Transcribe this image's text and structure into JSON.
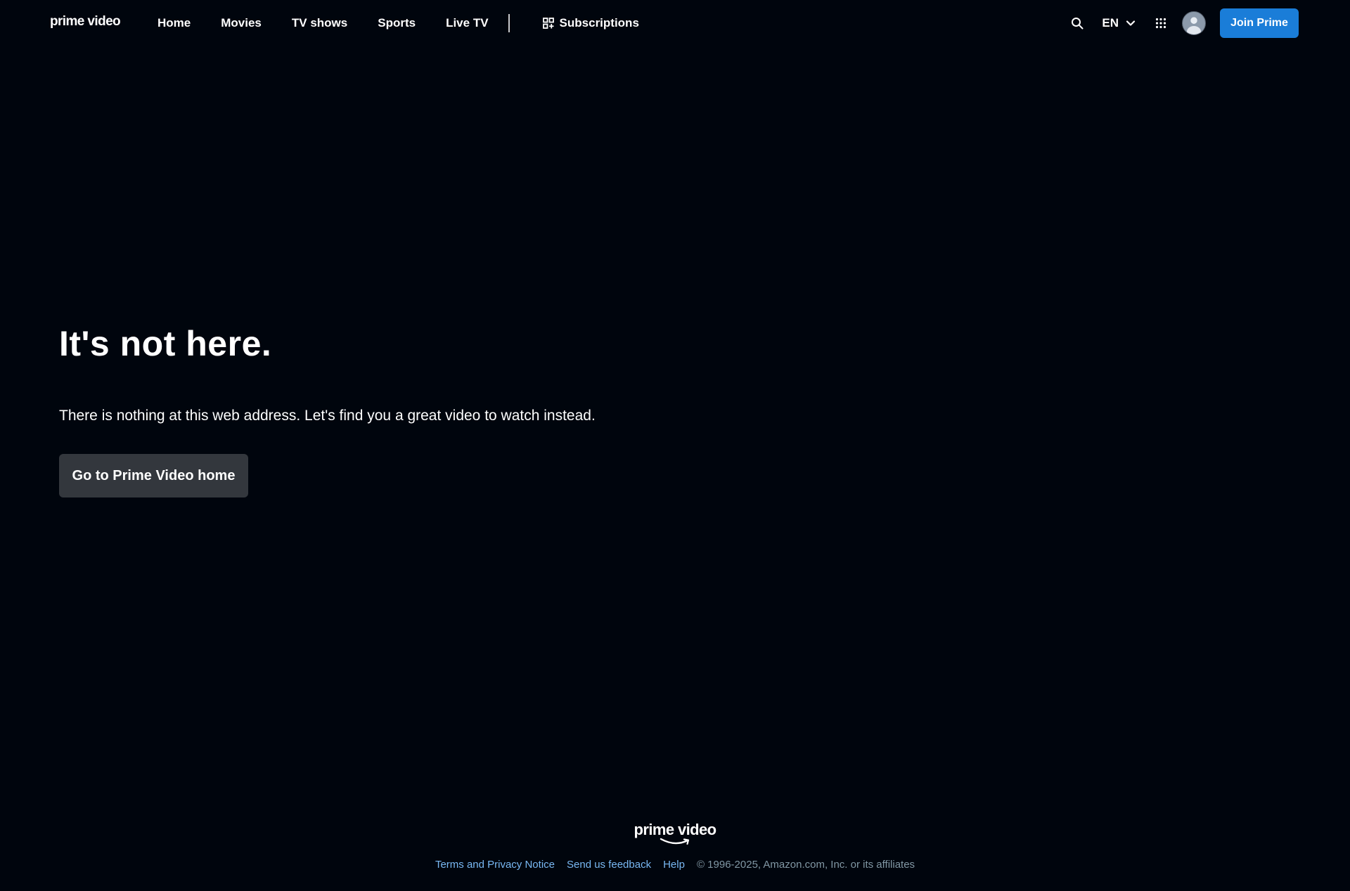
{
  "header": {
    "logo": "prime video",
    "nav": [
      "Home",
      "Movies",
      "TV shows",
      "Sports",
      "Live TV"
    ],
    "subscriptions_label": "Subscriptions",
    "language": "EN",
    "join_label": "Join Prime"
  },
  "main": {
    "headline": "It's not here.",
    "message": "There is nothing at this web address. Let's find you a great video to watch instead.",
    "home_button": "Go to Prime Video home"
  },
  "footer": {
    "logo": "prime video",
    "links": [
      "Terms and Privacy Notice",
      "Send us feedback",
      "Help"
    ],
    "copyright": "© 1996-2025, Amazon.com, Inc. or its affiliates"
  },
  "colors": {
    "background": "#00050d",
    "primary_button": "#1a7dd8",
    "secondary_button": "#33373d",
    "link": "#79b8f3"
  }
}
